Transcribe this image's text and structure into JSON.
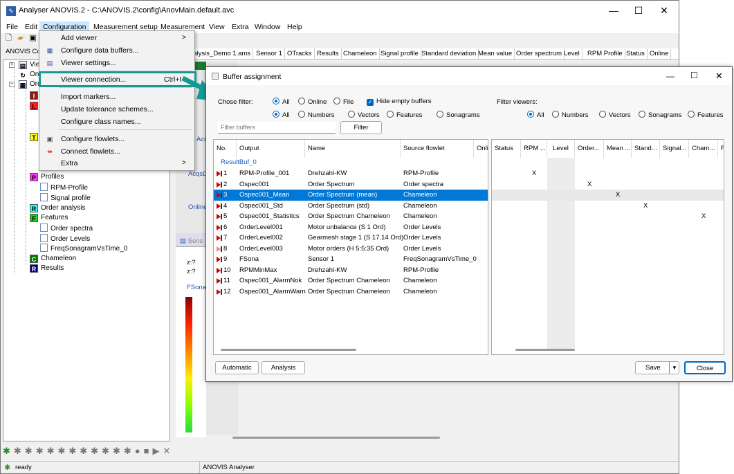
{
  "app": {
    "title": "Analyser ANOVIS.2 - C:\\ANOVIS.2\\config\\AnovMain.default.avc",
    "menu": [
      "File",
      "Edit",
      "Configuration",
      "Measurement setup",
      "Measurement",
      "View",
      "Extra",
      "Window",
      "Help"
    ],
    "panel_title": "ANOVIS Cor",
    "doc_tabs": [
      "nalysis_Demo 1.ams",
      "Sensor 1",
      "OTracks",
      "Results",
      "Chameleon",
      "Signal profile",
      "Standard deviation",
      "Mean value",
      "Order spectrum",
      "Level",
      "RPM Profile",
      "Status",
      "Online"
    ],
    "tree": [
      {
        "label": "Vie",
        "icon": "viewer-icon",
        "color": "#ffffff"
      },
      {
        "label": "On",
        "icon": "online-icon",
        "color": "#ffffff"
      },
      {
        "label": "Ord",
        "icon": "order-icon",
        "color": "#ffffff"
      },
      {
        "label": "I",
        "icon": "i-block-icon",
        "color": "#8b1a1a"
      },
      {
        "label": "L",
        "icon": "l-block-icon",
        "color": "#ff0000"
      },
      {
        "label": "T",
        "icon": "t-block-icon",
        "color": "#ffff00"
      },
      {
        "label": "Profiles",
        "icon": "p-block-icon",
        "color": "#ff00ff",
        "badge": "P"
      },
      {
        "label": "RPM-Profile",
        "icon": "doc-icon"
      },
      {
        "label": "Signal profile",
        "icon": "doc-icon"
      },
      {
        "label": "Order analysis",
        "icon": "r-block-icon",
        "color": "#00ffff",
        "badge": "R"
      },
      {
        "label": "Features",
        "icon": "f-block-icon",
        "color": "#00cc00",
        "badge": "F"
      },
      {
        "label": "Order spectra",
        "icon": "doc-icon"
      },
      {
        "label": "Order Levels",
        "icon": "doc-icon"
      },
      {
        "label": "FreqSonagramVsTime_0",
        "icon": "doc-icon"
      },
      {
        "label": "Chameleon",
        "icon": "c-block-icon",
        "color": "#008000",
        "badge": "C"
      },
      {
        "label": "Results",
        "icon": "r2-block-icon",
        "color": "#000080",
        "badge": "R"
      }
    ],
    "mid_labels": [
      "AcqsT",
      "AcqsD",
      "Online"
    ],
    "sensor_tab": "Sens",
    "sensor_readouts": [
      "z:?",
      "z:?"
    ],
    "sensor_label": "FSona",
    "status": {
      "text": "ready",
      "app_name": "ANOVIS Analyser"
    }
  },
  "context_menu": {
    "items": [
      {
        "label": "Add viewer",
        "arrow": ">"
      },
      {
        "label": "Configure data buffers...",
        "icon": "buffer-icon"
      },
      {
        "label": "Viewer settings...",
        "icon": "viewer-settings-icon"
      },
      {
        "label": "Viewer connection...",
        "shortcut": "Ctrl+I"
      },
      {
        "label": "Import markers..."
      },
      {
        "label": "Update tolerance schemes..."
      },
      {
        "label": "Configure class names..."
      },
      {
        "label": "Configure flowlets...",
        "icon": "flowlet-icon"
      },
      {
        "label": "Connect flowlets...",
        "icon": "connect-icon"
      },
      {
        "label": "Extra",
        "arrow": ">"
      }
    ]
  },
  "dialog": {
    "title": "Buffer assignment",
    "filter_label": "Chose filter:",
    "filter_row1": [
      "All",
      "Online",
      "File"
    ],
    "hide_empty": "Hide empty buffers",
    "filter_row2": [
      "All",
      "Numbers",
      "Vectors",
      "Features",
      "Sonagrams"
    ],
    "search_placeholder": "Filter buffers",
    "filter_button": "Filter",
    "viewers_label": "Filter viewers:",
    "viewer_filters": [
      "All",
      "Numbers",
      "Vectors",
      "Sonagrams",
      "Features"
    ],
    "left_columns": [
      "No.",
      "Output",
      "Name",
      "Source flowlet",
      "Onli"
    ],
    "group": "ResultBuf_0",
    "rows": [
      {
        "no": "1",
        "output": "RPM-Profile_001",
        "name": "Drehzahl-KW",
        "source": "RPM-Profile"
      },
      {
        "no": "2",
        "output": "Ospec001",
        "name": "Order Spectrum",
        "source": "Order spectra"
      },
      {
        "no": "3",
        "output": "Ospec001_Mean",
        "name": "Order Spectrum (mean)",
        "source": "Chameleon"
      },
      {
        "no": "4",
        "output": "Ospec001_Std",
        "name": "Order Spectrum (std)",
        "source": "Chameleon"
      },
      {
        "no": "5",
        "output": "Ospec001_Statistics",
        "name": "Order Spectrum Chameleon",
        "source": "Chameleon"
      },
      {
        "no": "6",
        "output": "OrderLevel001",
        "name": "Motor unbalance (S 1 Ord)",
        "source": "Order Levels"
      },
      {
        "no": "7",
        "output": "OrderLevel002",
        "name": "Gearmesh stage 1 (S 17.14 Ord)",
        "source": "Order Levels"
      },
      {
        "no": "8",
        "output": "OrderLevel003",
        "name": "Motor orders (H 5:5:35 Ord)",
        "source": "Order Levels"
      },
      {
        "no": "9",
        "output": "FSona",
        "name": "Sensor 1",
        "source": "FreqSonagramVsTime_0"
      },
      {
        "no": "10",
        "output": "RPMMinMax",
        "name": "Drehzahl-KW",
        "source": "RPM-Profile"
      },
      {
        "no": "11",
        "output": "Ospec001_AlarmNok",
        "name": "Order Spectrum Chameleon",
        "source": "Chameleon"
      },
      {
        "no": "12",
        "output": "Ospec001_AlarmWarn",
        "name": "Order Spectrum Chameleon",
        "source": "Chameleon"
      }
    ],
    "selected_row": 3,
    "right_columns": [
      "Status",
      "RPM ...",
      "Level",
      "Order...",
      "Mean ...",
      "Stand...",
      "Signal...",
      "Cham...",
      "F"
    ],
    "marks": [
      {
        "row": 1,
        "col": 1,
        "v": "X"
      },
      {
        "row": 2,
        "col": 3,
        "v": "X"
      },
      {
        "row": 3,
        "col": 4,
        "v": "X"
      },
      {
        "row": 4,
        "col": 5,
        "v": "X"
      },
      {
        "row": 5,
        "col": 7,
        "v": "X"
      }
    ],
    "buttons": {
      "automatic": "Automatic",
      "analysis": "Analysis",
      "save": "Save",
      "close": "Close"
    }
  }
}
